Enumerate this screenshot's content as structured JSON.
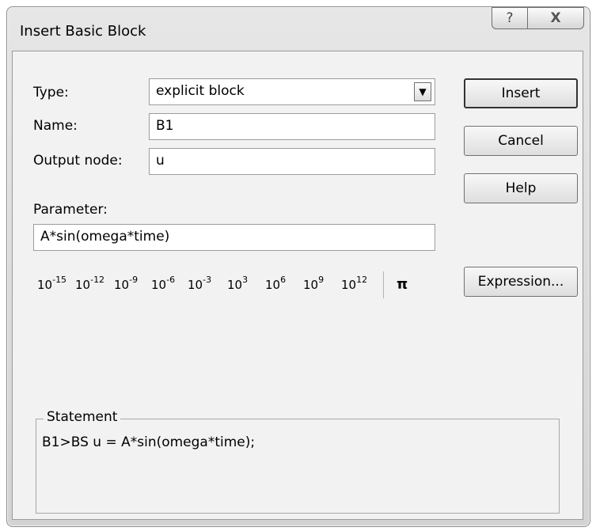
{
  "title": "Insert Basic Block",
  "caption": {
    "help": "?",
    "close": "X"
  },
  "labels": {
    "type": "Type:",
    "name": "Name:",
    "output_node": "Output node:",
    "parameter": "Parameter:"
  },
  "fields": {
    "type": "explicit block",
    "name": "B1",
    "output_node": "u",
    "parameter": "A*sin(omega*time)"
  },
  "buttons": {
    "insert": "Insert",
    "cancel": "Cancel",
    "help": "Help",
    "expression": "Expression..."
  },
  "exponent_buttons": [
    {
      "base": "10",
      "exp": "-15"
    },
    {
      "base": "10",
      "exp": "-12"
    },
    {
      "base": "10",
      "exp": "-9"
    },
    {
      "base": "10",
      "exp": "-6"
    },
    {
      "base": "10",
      "exp": "-3"
    },
    {
      "base": "10",
      "exp": "3"
    },
    {
      "base": "10",
      "exp": "6"
    },
    {
      "base": "10",
      "exp": "9"
    },
    {
      "base": "10",
      "exp": "12"
    }
  ],
  "pi": "π",
  "statement": {
    "legend": "Statement",
    "text": "B1>BS u = A*sin(omega*time);"
  }
}
